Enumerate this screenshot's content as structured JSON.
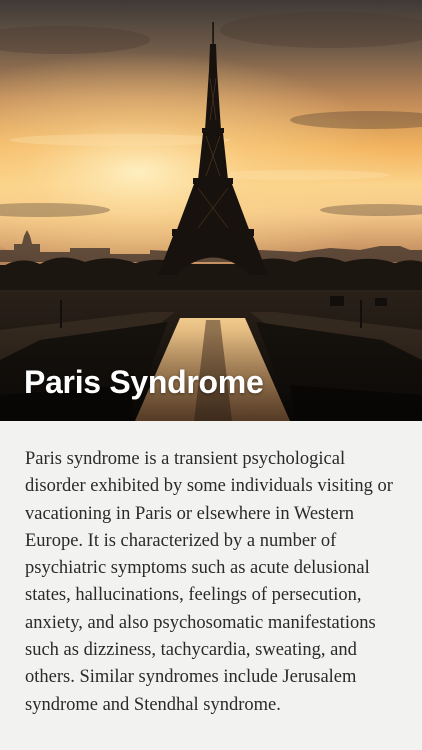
{
  "article": {
    "title": "Paris Syndrome",
    "body": "Paris syndrome is a transient psychological disorder exhibited by some individuals visiting or vacationing in Paris or elsewhere in Western Europe. It is characterized by a number of psychiatric symptoms such as acute delusional states, hallucinations, feelings of persecution, anxiety, and also psychosomatic manifestations such as dizziness, tachycardia, sweating, and others. Similar syndromes include Jerusalem syndrome and Stendhal syndrome."
  },
  "hero_image": {
    "subject": "eiffel-tower-sunset-photo"
  },
  "colors": {
    "sky_top": "#3f3a36",
    "sky_glow": "#f6b45a",
    "horizon": "#fbe0a2",
    "silhouette": "#17120e",
    "body_background": "#f2f2f1",
    "body_text": "#2a2a2a",
    "title_text": "#ffffff"
  }
}
